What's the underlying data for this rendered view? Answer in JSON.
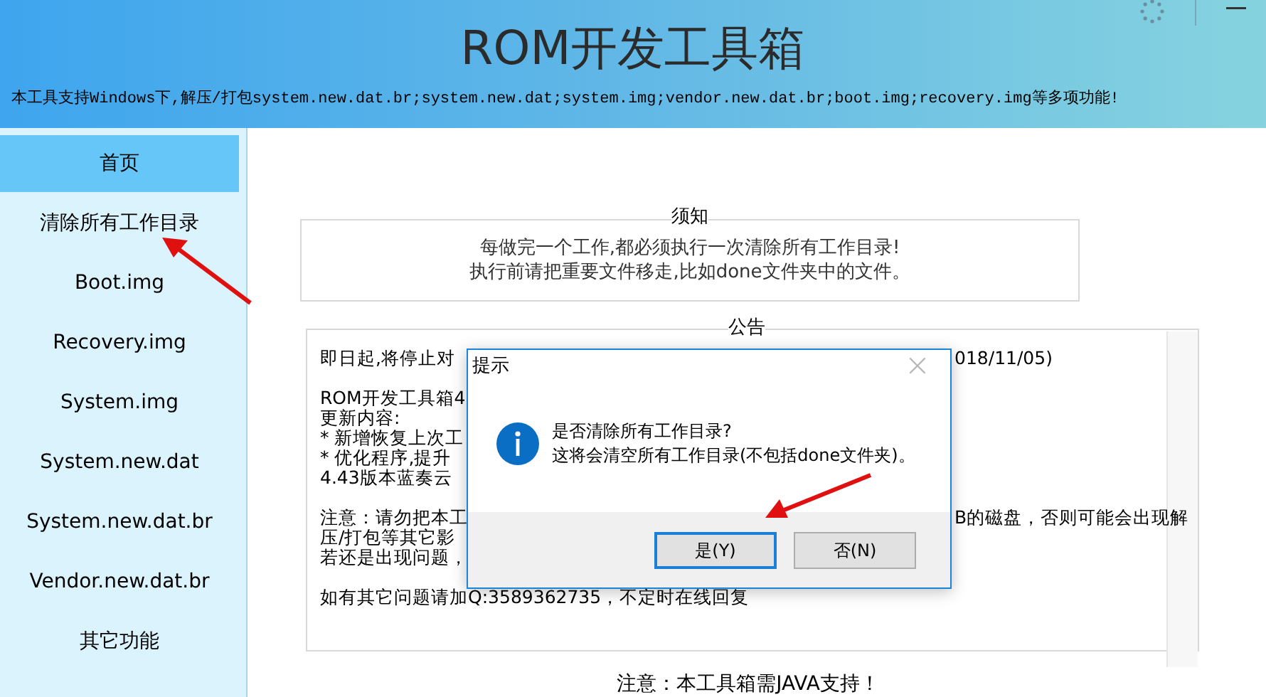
{
  "window": {
    "title": "ROM开发工具箱",
    "subtitle": "本工具支持Windows下,解压/打包system.new.dat.br;system.new.dat;system.img;vendor.new.dat.br;boot.img;recovery.img等多项功能!"
  },
  "sidebar": {
    "items": [
      {
        "label": "首页",
        "selected": true
      },
      {
        "label": "清除所有工作目录",
        "selected": false
      },
      {
        "label": "Boot.img",
        "selected": false
      },
      {
        "label": "Recovery.img",
        "selected": false
      },
      {
        "label": "System.img",
        "selected": false
      },
      {
        "label": "System.new.dat",
        "selected": false
      },
      {
        "label": "System.new.dat.br",
        "selected": false
      },
      {
        "label": "Vendor.new.dat.br",
        "selected": false
      },
      {
        "label": "其它功能",
        "selected": false
      }
    ]
  },
  "notice": {
    "title": "须知",
    "lines": [
      "每做完一个工作,都必须执行一次清除所有工作目录!",
      "执行前请把重要文件移走,比如done文件夹中的文件。"
    ]
  },
  "announcement": {
    "title": "公告",
    "paragraphs": [
      [
        {
          "left": "即日起,将停止对",
          "right": "018/11/05)"
        }
      ],
      [
        {
          "left": "ROM开发工具箱4"
        },
        {
          "left": "更新内容:"
        },
        {
          "left": "* 新增恢复上次工"
        },
        {
          "left": "* 优化程序,提升"
        },
        {
          "left": "4.43版本蓝奏云"
        }
      ],
      [
        {
          "left": "注意：请勿把本工",
          "right": "B的磁盘，否则可能会出现解"
        },
        {
          "left": "压/打包等其它影"
        },
        {
          "left": "若还是出现问题，"
        }
      ],
      [
        {
          "left": "如有其它问题请加Q:3589362735，不定时在线回复"
        }
      ]
    ]
  },
  "footer_note": "注意：本工具箱需JAVA支持！",
  "dialog": {
    "title": "提示",
    "close": "×",
    "message": "是否清除所有工作目录?",
    "detail": "这将会清空所有工作目录(不包括done文件夹)。",
    "buttons": [
      {
        "label": "是(Y)",
        "selected": true
      },
      {
        "label": "否(N)",
        "selected": false
      }
    ]
  }
}
